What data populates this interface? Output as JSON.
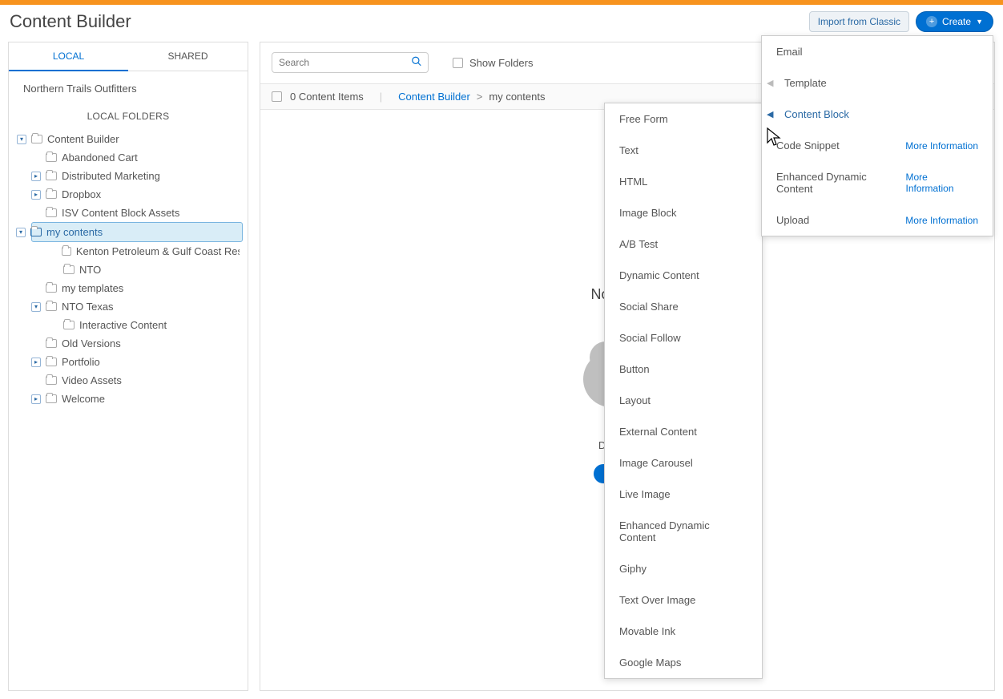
{
  "header": {
    "title": "Content Builder",
    "import_label": "Import from Classic",
    "create_label": "Create"
  },
  "sidebar": {
    "tabs": {
      "local": "LOCAL",
      "shared": "SHARED"
    },
    "workspace": "Northern Trails Outfitters",
    "local_folders_title": "LOCAL FOLDERS",
    "tree": {
      "root": "Content Builder",
      "items": [
        "Abandoned Cart",
        "Distributed Marketing",
        "Dropbox",
        "ISV Content Block Assets",
        "my contents",
        "Kenton Petroleum & Gulf Coast Resources",
        "NTO",
        "my templates",
        "NTO Texas",
        "Interactive Content",
        "Old Versions",
        "Portfolio",
        "Video Assets",
        "Welcome"
      ]
    }
  },
  "toolbar": {
    "search_placeholder": "Search",
    "show_folders": "Show Folders"
  },
  "subheader": {
    "count": "0 Content Items",
    "breadcrumb_root": "Content Builder",
    "breadcrumb_current": "my contents"
  },
  "empty": {
    "title": "No Content",
    "drop": "Drag & Drop",
    "create": "Create"
  },
  "dropdown_primary": {
    "items": [
      {
        "label": "Email",
        "arrow": false
      },
      {
        "label": "Template",
        "arrow": true,
        "dim": true
      },
      {
        "label": "Content Block",
        "arrow": true,
        "active": true
      },
      {
        "label": "Code Snippet",
        "arrow": false,
        "link": "More Information"
      },
      {
        "label": "Enhanced Dynamic Content",
        "arrow": false,
        "link": "More Information"
      },
      {
        "label": "Upload",
        "arrow": false,
        "link": "More Information"
      }
    ]
  },
  "dropdown_secondary": {
    "items": [
      "Free Form",
      "Text",
      "HTML",
      "Image Block",
      "A/B Test",
      "Dynamic Content",
      "Social Share",
      "Social Follow",
      "Button",
      "Layout",
      "External Content",
      "Image Carousel",
      "Live Image",
      "Enhanced Dynamic Content",
      "Giphy",
      "Text Over Image",
      "Movable Ink",
      "Google Maps"
    ]
  }
}
